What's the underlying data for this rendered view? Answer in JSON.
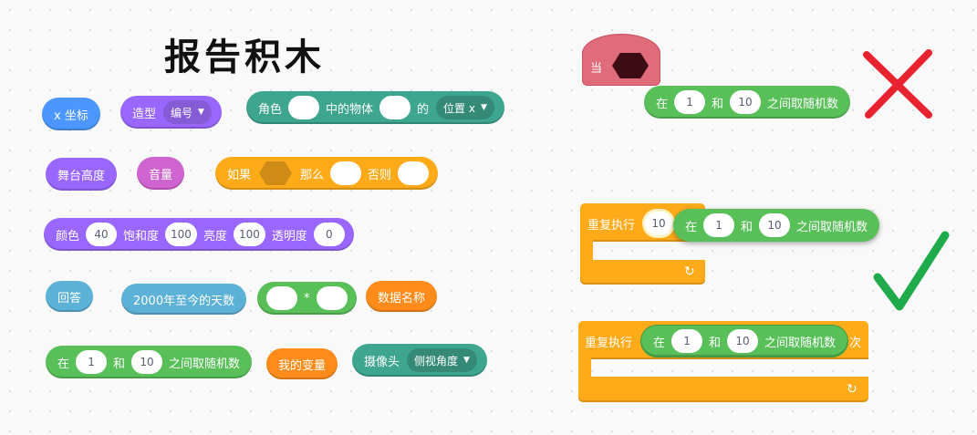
{
  "title": "报告积木",
  "blocks": {
    "x_pos": "x 坐标",
    "costume": {
      "label": "造型",
      "dropdown": "编号"
    },
    "of": {
      "label1": "角色",
      "label2": "中的物体",
      "label3": "的",
      "dropdown": "位置 x"
    },
    "backdrop_height": "舞台高度",
    "volume": "音量",
    "if_then_else": {
      "label1": "如果",
      "label2": "那么",
      "label3": "否则"
    },
    "color": {
      "label1": "颜色",
      "val1": "40",
      "label2": "饱和度",
      "val2": "100",
      "label3": "亮度",
      "val3": "100",
      "label4": "透明度",
      "val4": "0"
    },
    "answer": "回答",
    "days_since": "2000年至今的天数",
    "multiply": "*",
    "data_name": "数据名称",
    "random": {
      "label1": "在",
      "from": "1",
      "label2": "和",
      "to": "10",
      "label3": "之间取随机数"
    },
    "my_variable": "我的变量",
    "camera": {
      "label": "摄像头",
      "dropdown": "侧视角度"
    }
  },
  "right": {
    "hat_label": "当",
    "random_wrong": {
      "label1": "在",
      "from": "1",
      "label2": "和",
      "to": "10",
      "label3": "之间取随机数"
    },
    "repeat1": {
      "label": "重复执行",
      "count": "10"
    },
    "random_drag": {
      "label1": "在",
      "from": "1",
      "label2": "和",
      "to": "10",
      "label3": "之间取随机数"
    },
    "repeat2": {
      "label": "重复执行",
      "suffix": "次"
    },
    "random_inside": {
      "label1": "在",
      "from": "1",
      "label2": "和",
      "to": "10",
      "label3": "之间取随机数"
    }
  },
  "icons": {
    "wrong": "red-cross-icon",
    "right": "green-check-icon",
    "loop": "loop-arrow-icon"
  },
  "colors": {
    "motion": "#4c97ff",
    "looks": "#9966ff",
    "sound": "#cf63cf",
    "sensing": "#5cb1d6",
    "operators": "#59c059",
    "control": "#ffab19",
    "variables": "#ff8c1a",
    "extension": "#3ea58e",
    "events_hat": "#e06b7a",
    "cross": "#e8222e",
    "check": "#1faa4b"
  }
}
